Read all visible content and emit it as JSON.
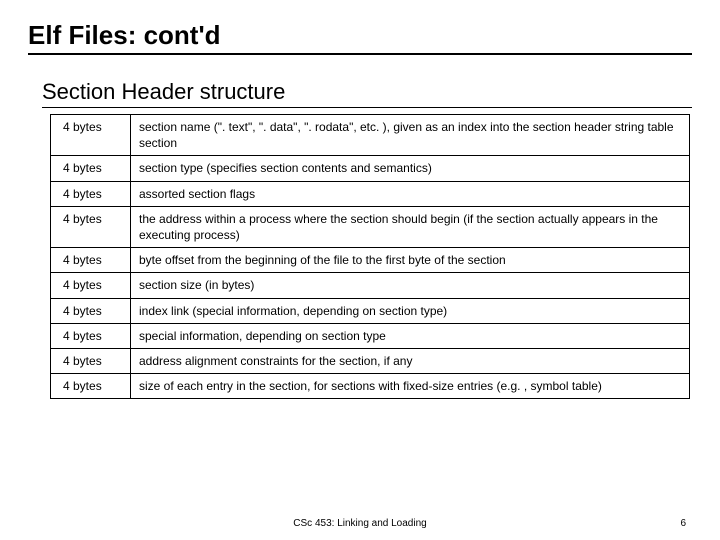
{
  "title": "Elf Files: cont'd",
  "subtitle": "Section Header structure",
  "rows": [
    {
      "size": "4 bytes",
      "desc": "section name (\". text\", \". data\", \". rodata\", etc. ), given as an index into the section header string table section"
    },
    {
      "size": "4 bytes",
      "desc": "section type (specifies section contents and semantics)"
    },
    {
      "size": "4 bytes",
      "desc": "assorted section flags"
    },
    {
      "size": "4 bytes",
      "desc": "the address within a process where the section should begin (if the section actually appears in the executing process)"
    },
    {
      "size": "4 bytes",
      "desc": "byte offset from the beginning of the file to the first byte of the section"
    },
    {
      "size": "4 bytes",
      "desc": "section size (in bytes)"
    },
    {
      "size": "4 bytes",
      "desc": "index link (special information, depending on section type)"
    },
    {
      "size": "4 bytes",
      "desc": "special information, depending on section type"
    },
    {
      "size": "4 bytes",
      "desc": "address alignment constraints for the section, if any"
    },
    {
      "size": "4 bytes",
      "desc": "size of each entry in the section, for sections with fixed-size entries (e.g. , symbol table)"
    }
  ],
  "footer_center": "CSc 453: Linking and Loading",
  "footer_right": "6"
}
